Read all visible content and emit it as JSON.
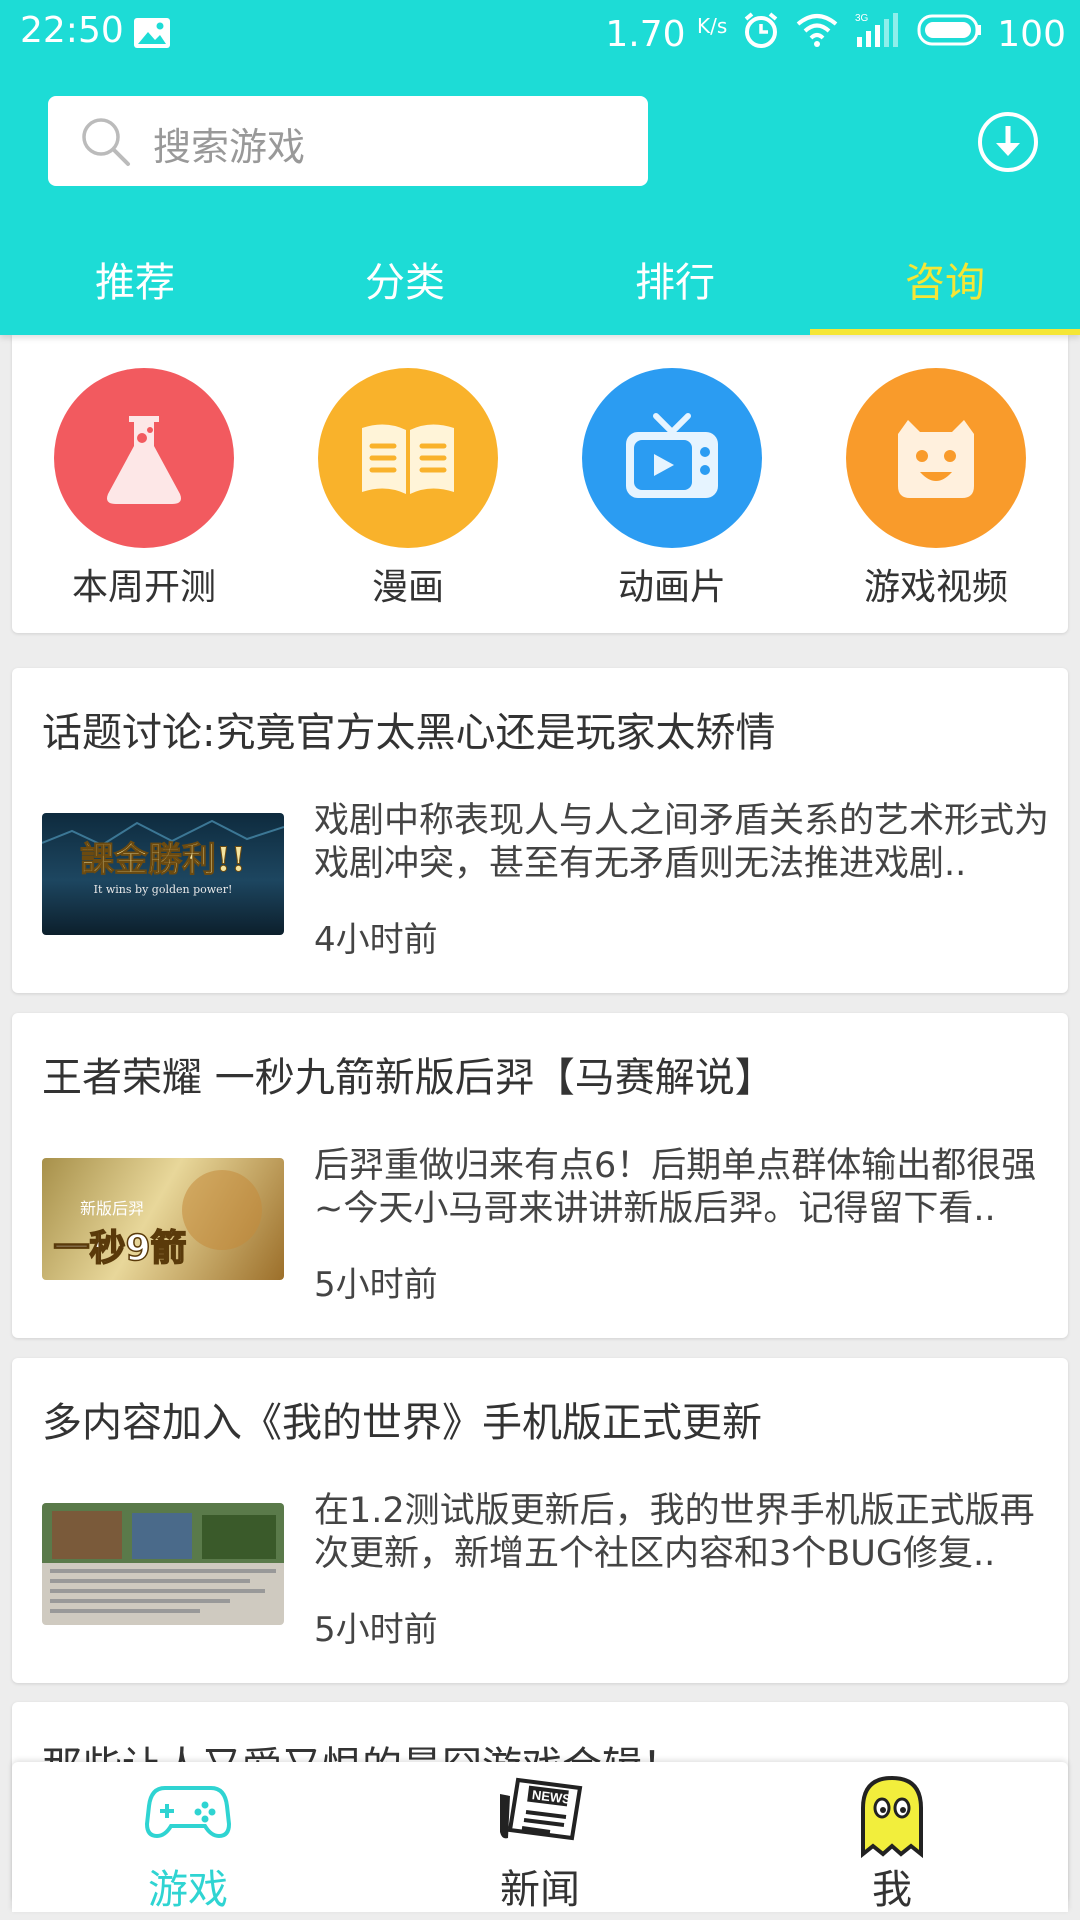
{
  "status_bar": {
    "time": "22:50",
    "net_speed": "1.70",
    "net_unit": "K/s",
    "network": "3G",
    "battery": "100"
  },
  "search": {
    "placeholder": "搜索游戏"
  },
  "tabs": [
    {
      "label": "推荐",
      "active": false
    },
    {
      "label": "分类",
      "active": false
    },
    {
      "label": "排行",
      "active": false
    },
    {
      "label": "咨询",
      "active": true
    }
  ],
  "categories": [
    {
      "label": "本周开测",
      "icon": "flask-icon",
      "color": "#f25a5f"
    },
    {
      "label": "漫画",
      "icon": "book-icon",
      "color": "#f9b22b"
    },
    {
      "label": "动画片",
      "icon": "tv-icon",
      "color": "#2b9cf2"
    },
    {
      "label": "游戏视频",
      "icon": "monster-face-icon",
      "color": "#f99b2b"
    }
  ],
  "news": [
    {
      "title": "话题讨论:究竟官方太黑心还是玩家太矫情",
      "summary": "戏剧中称表现人与人之间矛盾关系的艺术形式为戏剧冲突，甚至有无矛盾则无法推进戏剧..",
      "time": "4小时前",
      "thumb_text": "課金勝利!!",
      "thumb_sub": "It wins by golden power!"
    },
    {
      "title": "王者荣耀 一秒九箭新版后羿【马赛解说】",
      "summary": "后羿重做归来有点6！后期单点群体输出都很强~今天小马哥来讲讲新版后羿。记得留下看..",
      "time": "5小时前",
      "thumb_text": "一秒9箭",
      "thumb_sub": "新版后羿"
    },
    {
      "title": "多内容加入《我的世界》手机版正式更新",
      "summary": "在1.2测试版更新后，我的世界手机版正式版再次更新，新增五个社区内容和3个BUG修复..",
      "time": "5小时前",
      "thumb_text": "",
      "thumb_sub": ""
    }
  ],
  "partial_news_title": "那些让人又爱又恨的最囧游戏合辑！",
  "bottom_nav": [
    {
      "label": "游戏",
      "icon": "gamepad-icon",
      "active": true
    },
    {
      "label": "新闻",
      "icon": "newspaper-icon",
      "active": false
    },
    {
      "label": "我",
      "icon": "ghost-icon",
      "active": false
    }
  ],
  "colors": {
    "header": "#1ddcd6",
    "active_tab": "#f5e636",
    "active_nav": "#2fd4d2"
  }
}
